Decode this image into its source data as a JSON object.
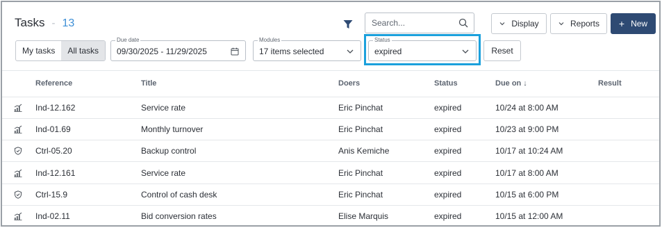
{
  "header": {
    "title": "Tasks",
    "separator": "-",
    "count": "13"
  },
  "toolbar": {
    "search_placeholder": "Search...",
    "display_label": "Display",
    "reports_label": "Reports",
    "new_plus": "+",
    "new_label": "New"
  },
  "filters": {
    "my_tasks": "My tasks",
    "all_tasks": "All tasks",
    "due_date": {
      "legend": "Due date",
      "value": "09/30/2025 - 11/29/2025"
    },
    "modules": {
      "legend": "Modules",
      "value": "17 items selected"
    },
    "status": {
      "legend": "Status",
      "value": "expired"
    },
    "reset_label": "Reset"
  },
  "table": {
    "columns": {
      "reference": "Reference",
      "title": "Title",
      "doers": "Doers",
      "status": "Status",
      "due_on": "Due on",
      "due_sort": "↓",
      "result": "Result"
    },
    "rows": [
      {
        "icon": "chart-icon",
        "reference": "Ind-12.162",
        "title": "Service rate",
        "doers": "Eric Pinchat",
        "status": "expired",
        "due_on": "10/24 at 8:00 AM",
        "result": ""
      },
      {
        "icon": "chart-icon",
        "reference": "Ind-01.69",
        "title": "Monthly turnover",
        "doers": "Eric Pinchat",
        "status": "expired",
        "due_on": "10/23 at 9:00 PM",
        "result": ""
      },
      {
        "icon": "shield-icon",
        "reference": "Ctrl-05.20",
        "title": "Backup control",
        "doers": "Anis Kemiche",
        "status": "expired",
        "due_on": "10/17 at 10:24 AM",
        "result": ""
      },
      {
        "icon": "chart-icon",
        "reference": "Ind-12.161",
        "title": "Service rate",
        "doers": "Eric Pinchat",
        "status": "expired",
        "due_on": "10/17 at 8:00 AM",
        "result": ""
      },
      {
        "icon": "shield-icon",
        "reference": "Ctrl-15.9",
        "title": "Control of cash desk",
        "doers": "Eric Pinchat",
        "status": "expired",
        "due_on": "10/15 at 6:00 PM",
        "result": ""
      },
      {
        "icon": "chart-icon",
        "reference": "Ind-02.11",
        "title": "Bid conversion rates",
        "doers": "Elise Marquis",
        "status": "expired",
        "due_on": "10/15 at 12:00 AM",
        "result": ""
      }
    ]
  },
  "colors": {
    "accent_count": "#3d8fd6",
    "primary_button": "#2e4a73",
    "highlight": "#1ba0dc",
    "filter_icon": "#2e4a73"
  }
}
